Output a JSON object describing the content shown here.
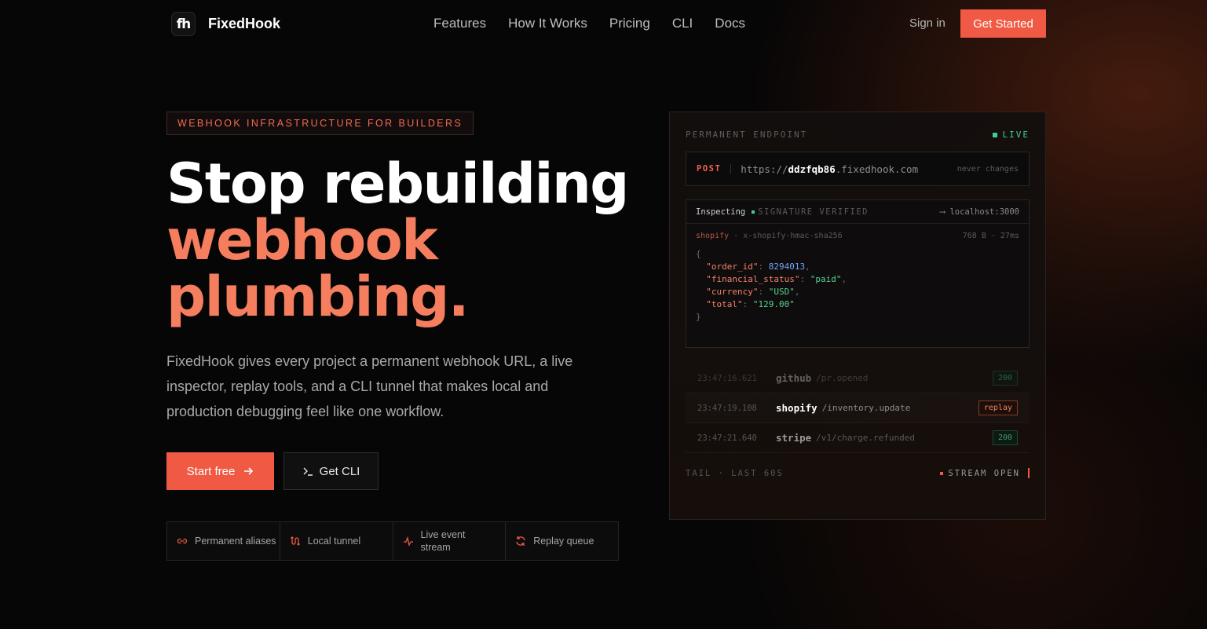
{
  "nav": {
    "logo_text": "fh",
    "brand": "FixedHook",
    "links": [
      "Features",
      "How It Works",
      "Pricing",
      "CLI",
      "Docs"
    ],
    "signin": "Sign in",
    "cta": "Get Started"
  },
  "hero": {
    "badge": "WEBHOOK INFRASTRUCTURE FOR BUILDERS",
    "title_line1": "Stop rebuilding",
    "title_line2": "webhook",
    "title_line3": "plumbing.",
    "subtitle": "FixedHook gives every project a permanent webhook URL, a live inspector, replay tools, and a CLI tunnel that makes local and production debugging feel like one workflow.",
    "btn_primary": "Start free",
    "btn_secondary": "Get CLI",
    "features": [
      {
        "label": "Permanent aliases",
        "icon": "link-icon"
      },
      {
        "label": "Local tunnel",
        "icon": "tunnel-icon"
      },
      {
        "label": "Live event stream",
        "icon": "pulse-icon"
      },
      {
        "label": "Replay queue",
        "icon": "refresh-icon"
      }
    ]
  },
  "panel": {
    "label": "PERMANENT ENDPOINT",
    "live": "LIVE",
    "method": "POST",
    "url_prefix": "https://",
    "url_id": "ddzfqb86",
    "url_suffix": ".fixedhook.com",
    "url_note": "never changes",
    "inspect_title": "Inspecting",
    "verified": "SIGNATURE VERIFIED",
    "target": "⟶ localhost:3000",
    "meta_source": "shopify",
    "meta_sep": " · ",
    "meta_header": "x-shopify-hmac-sha256",
    "meta_right": "768 B · 27ms",
    "json": {
      "order_id_key": "\"order_id\"",
      "order_id": "8294013",
      "fin_key": "\"financial_status\"",
      "fin": "\"paid\"",
      "cur_key": "\"currency\"",
      "cur": "\"USD\"",
      "total_key": "\"total\"",
      "total": "\"129.00\""
    },
    "events": [
      {
        "time": "23:47:16.621",
        "source": "github",
        "path": "/pr.opened",
        "tag": "200"
      },
      {
        "time": "23:47:19.108",
        "source": "shopify",
        "path": "/inventory.update",
        "tag": "replay"
      },
      {
        "time": "23:47:21.640",
        "source": "stripe",
        "path": "/v1/charge.refunded",
        "tag": "200"
      }
    ],
    "tail_left": "TAIL · LAST 60S",
    "tail_right": "STREAM OPEN"
  },
  "colors": {
    "accent": "#f05a44",
    "accent_soft": "#f57e5e",
    "live": "#3ecf8e"
  }
}
